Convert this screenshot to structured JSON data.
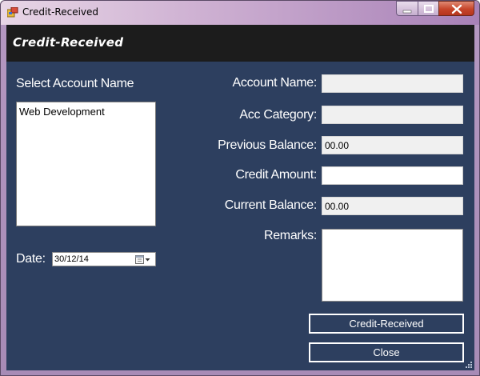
{
  "window": {
    "title": "Credit-Received",
    "controls": [
      "minimize-icon",
      "maximize-icon",
      "close-icon"
    ]
  },
  "header": {
    "title": "Credit-Received"
  },
  "left": {
    "select_account_label": "Select Account Name",
    "accounts": [
      "Web Development"
    ],
    "date_label": "Date:",
    "date_value": "30/12/14"
  },
  "form": {
    "account_name_label": "Account Name:",
    "account_name_value": "",
    "acc_category_label": "Acc Category:",
    "acc_category_value": "",
    "previous_balance_label": "Previous Balance:",
    "previous_balance_value": "00.00",
    "credit_amount_label": "Credit Amount:",
    "credit_amount_value": "",
    "current_balance_label": "Current Balance:",
    "current_balance_value": "00.00",
    "remarks_label": "Remarks:",
    "remarks_value": ""
  },
  "buttons": {
    "credit_received": "Credit-Received",
    "close": "Close"
  },
  "colors": {
    "client_bg": "#2d3f5f",
    "header_bg": "#1c1c1c",
    "text": "#ffffff"
  }
}
